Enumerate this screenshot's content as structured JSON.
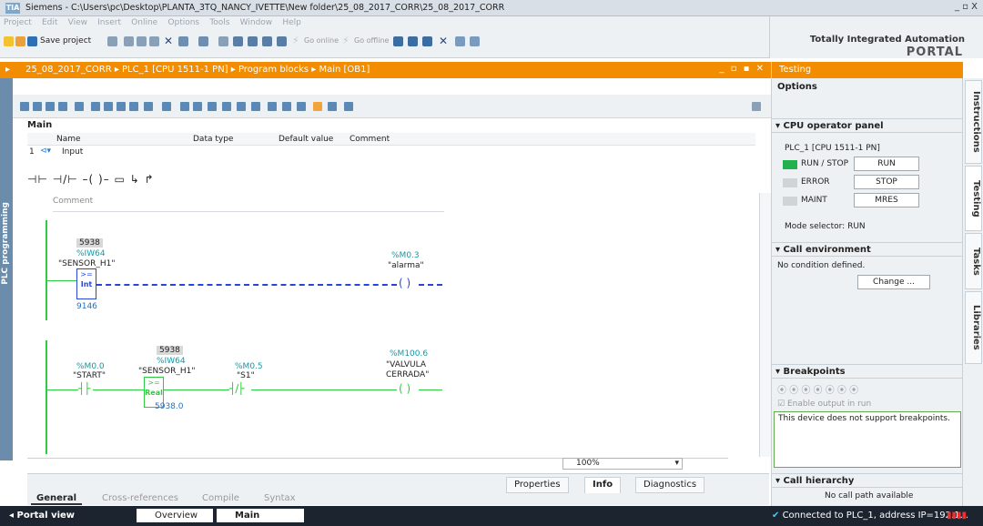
{
  "window": {
    "title": "Siemens - C:\\Users\\pc\\Desktop\\PLANTA_3TQ_NANCY_IVETTE\\New folder\\25_08_2017_CORR\\25_08_2017_CORR",
    "logo": "TIA",
    "controls": "_ ▫ X"
  },
  "menu": [
    "Project",
    "Edit",
    "View",
    "Insert",
    "Online",
    "Options",
    "Tools",
    "Window",
    "Help"
  ],
  "toolbar": {
    "save_label": "Save project",
    "go_online": "Go online",
    "go_offline": "Go offline"
  },
  "brand": {
    "line1": "Totally Integrated Automation",
    "line2": "PORTAL"
  },
  "breadcrumb": "25_08_2017_CORR  ▸  PLC_1 [CPU 1511-1 PN]  ▸  Program blocks  ▸  Main [OB1]",
  "side_label": "PLC programming",
  "interface": {
    "block": "Main",
    "cols": [
      "Name",
      "Data type",
      "Default value",
      "Comment"
    ],
    "row_num": "1",
    "row_name": "Input"
  },
  "network": {
    "comment": "Comment",
    "n1": {
      "val": "5938",
      "addr": "%IW64",
      "tag": "\"SENSOR_H1\"",
      "op": ">=",
      "type": "Int",
      "cmpval": "9146",
      "coil_addr": "%M0.3",
      "coil_tag": "\"alarma\""
    },
    "n2": {
      "start_addr": "%M0.0",
      "start_tag": "\"START\"",
      "val": "5938",
      "addr": "%IW64",
      "tag": "\"SENSOR_H1\"",
      "op": ">=",
      "type": "Real",
      "cmpval": "5938.0",
      "s1_addr": "%M0.5",
      "s1_tag": "\"S1\"",
      "coil_addr": "%M100.6",
      "coil_tag1": "\"VALVULA",
      "coil_tag2": "CERRADA\""
    }
  },
  "zoom": "100%",
  "bottom_tabs": {
    "properties": "Properties",
    "info": "Info",
    "diagnostics": "Diagnostics"
  },
  "low_tabs": [
    "General",
    "Cross-references",
    "Compile",
    "Syntax"
  ],
  "status": {
    "portal": "◂  Portal view",
    "overview": "Overview",
    "main": "Main",
    "connection": "Connected to PLC_1, address IP=192.1..."
  },
  "right_panel": {
    "header": "Testing",
    "options": "Options",
    "cpu": {
      "title": "CPU operator panel",
      "plc": "PLC_1 [CPU 1511-1 PN]",
      "run_stop": "RUN / STOP",
      "error": "ERROR",
      "maint": "MAINT",
      "btn_run": "RUN",
      "btn_stop": "STOP",
      "btn_mres": "MRES",
      "mode": "Mode selector:  RUN"
    },
    "call_env": {
      "title": "Call environment",
      "text": "No condition defined.",
      "btn": "Change ..."
    },
    "breakpoints": {
      "title": "Breakpoints",
      "enable": "Enable output in run",
      "msg": "This device does not support breakpoints."
    },
    "call_hier": {
      "title": "Call hierarchy",
      "msg": "No call path available"
    }
  },
  "vtabs": [
    "Instructions",
    "Testing",
    "Tasks",
    "Libraries"
  ],
  "colors": {
    "orange": "#f28c00",
    "rail": "#2ecc40",
    "wire_blue": "#2845d6",
    "addr": "#0e9aa7",
    "run_led": "#22b14c"
  }
}
